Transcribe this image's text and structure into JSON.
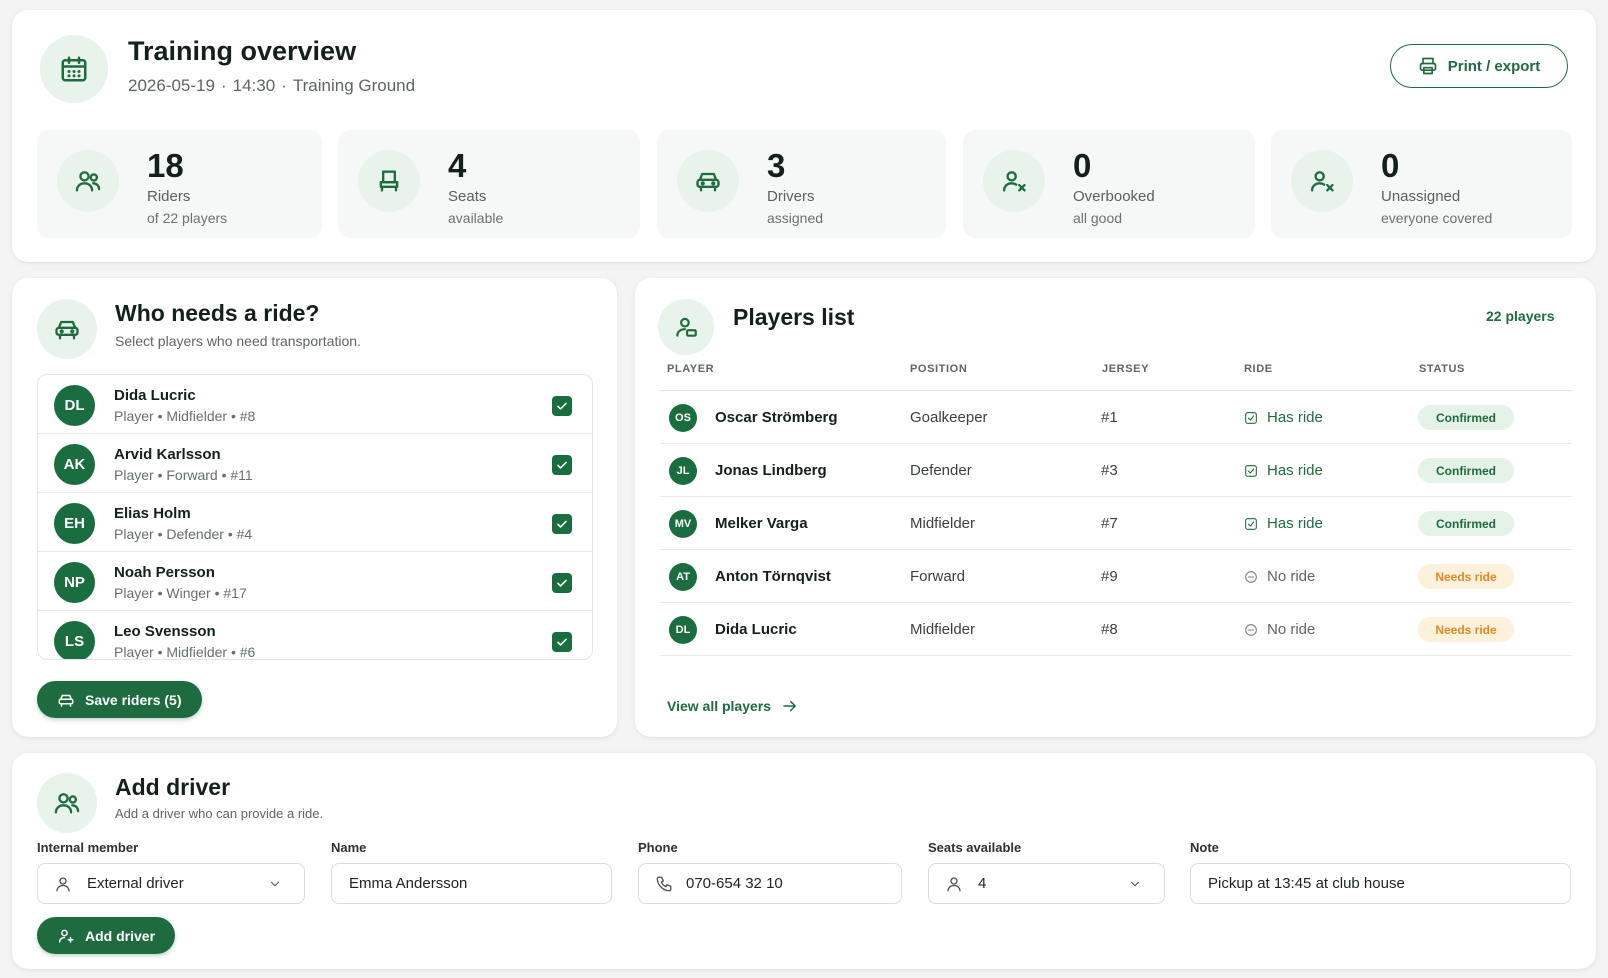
{
  "header": {
    "title": "Training overview",
    "date": "2026-05-19",
    "time": "14:30",
    "location": "Training Ground",
    "sep": "·",
    "print_label": "Print / export",
    "icon": "calendar-icon"
  },
  "stats": [
    {
      "value": "18",
      "label": "Riders",
      "sub": "of 22 players",
      "icon": "users-icon"
    },
    {
      "value": "4",
      "label": "Seats",
      "sub": "available",
      "icon": "seat-icon"
    },
    {
      "value": "3",
      "label": "Drivers",
      "sub": "assigned",
      "icon": "car-icon"
    },
    {
      "value": "0",
      "label": "Overbooked",
      "sub": "all good",
      "icon": "user-x-icon"
    },
    {
      "value": "0",
      "label": "Unassigned",
      "sub": "everyone covered",
      "icon": "user-x-icon"
    }
  ],
  "ride_panel": {
    "title": "Who needs a ride?",
    "subtitle": "Select players who need transportation.",
    "players": [
      {
        "initials": "DL",
        "name": "Dida Lucric",
        "meta": "Player  •  Midfielder  •  #8",
        "checked": true
      },
      {
        "initials": "AK",
        "name": "Arvid Karlsson",
        "meta": "Player  •  Forward  •  #11",
        "checked": true
      },
      {
        "initials": "EH",
        "name": "Elias Holm",
        "meta": "Player  •  Defender  •  #4",
        "checked": true
      },
      {
        "initials": "NP",
        "name": "Noah Persson",
        "meta": "Player  •  Winger  •  #17",
        "checked": true
      },
      {
        "initials": "LS",
        "name": "Leo Svensson",
        "meta": "Player  •  Midfielder  •  #6",
        "checked": true
      }
    ],
    "save_label": "Save riders (5)"
  },
  "players_list": {
    "title": "Players list",
    "count_label": "22 players",
    "columns": [
      "PLAYER",
      "POSITION",
      "JERSEY",
      "RIDE",
      "STATUS"
    ],
    "rows": [
      {
        "initials": "OS",
        "name": "Oscar Strömberg",
        "position": "Goalkeeper",
        "jersey": "#1",
        "ride": "Has ride",
        "status": "Confirmed"
      },
      {
        "initials": "JL",
        "name": "Jonas Lindberg",
        "position": "Defender",
        "jersey": "#3",
        "ride": "Has ride",
        "status": "Confirmed"
      },
      {
        "initials": "MV",
        "name": "Melker Varga",
        "position": "Midfielder",
        "jersey": "#7",
        "ride": "Has ride",
        "status": "Confirmed"
      },
      {
        "initials": "AT",
        "name": "Anton Törnqvist",
        "position": "Forward",
        "jersey": "#9",
        "ride": "No ride",
        "status": "Needs ride"
      },
      {
        "initials": "DL",
        "name": "Dida Lucric",
        "position": "Midfielder",
        "jersey": "#8",
        "ride": "No ride",
        "status": "Needs ride"
      }
    ],
    "view_all_label": "View all players"
  },
  "add_driver": {
    "title": "Add driver",
    "subtitle": "Add a driver who can provide a ride.",
    "internal_member": {
      "label": "Internal member",
      "value": "External driver"
    },
    "name": {
      "label": "Name",
      "value": "Emma Andersson"
    },
    "phone": {
      "label": "Phone",
      "value": "070-654 32 10"
    },
    "seats": {
      "label": "Seats available",
      "value": "4"
    },
    "note": {
      "label": "Note",
      "value": "Pickup at 13:45 at club house"
    },
    "button_label": "Add driver"
  },
  "colors": {
    "accent": "#1e6b40",
    "accent_light": "#e8f3ec",
    "warn_bg": "#fdf1dc",
    "warn_text": "#e08a20"
  }
}
